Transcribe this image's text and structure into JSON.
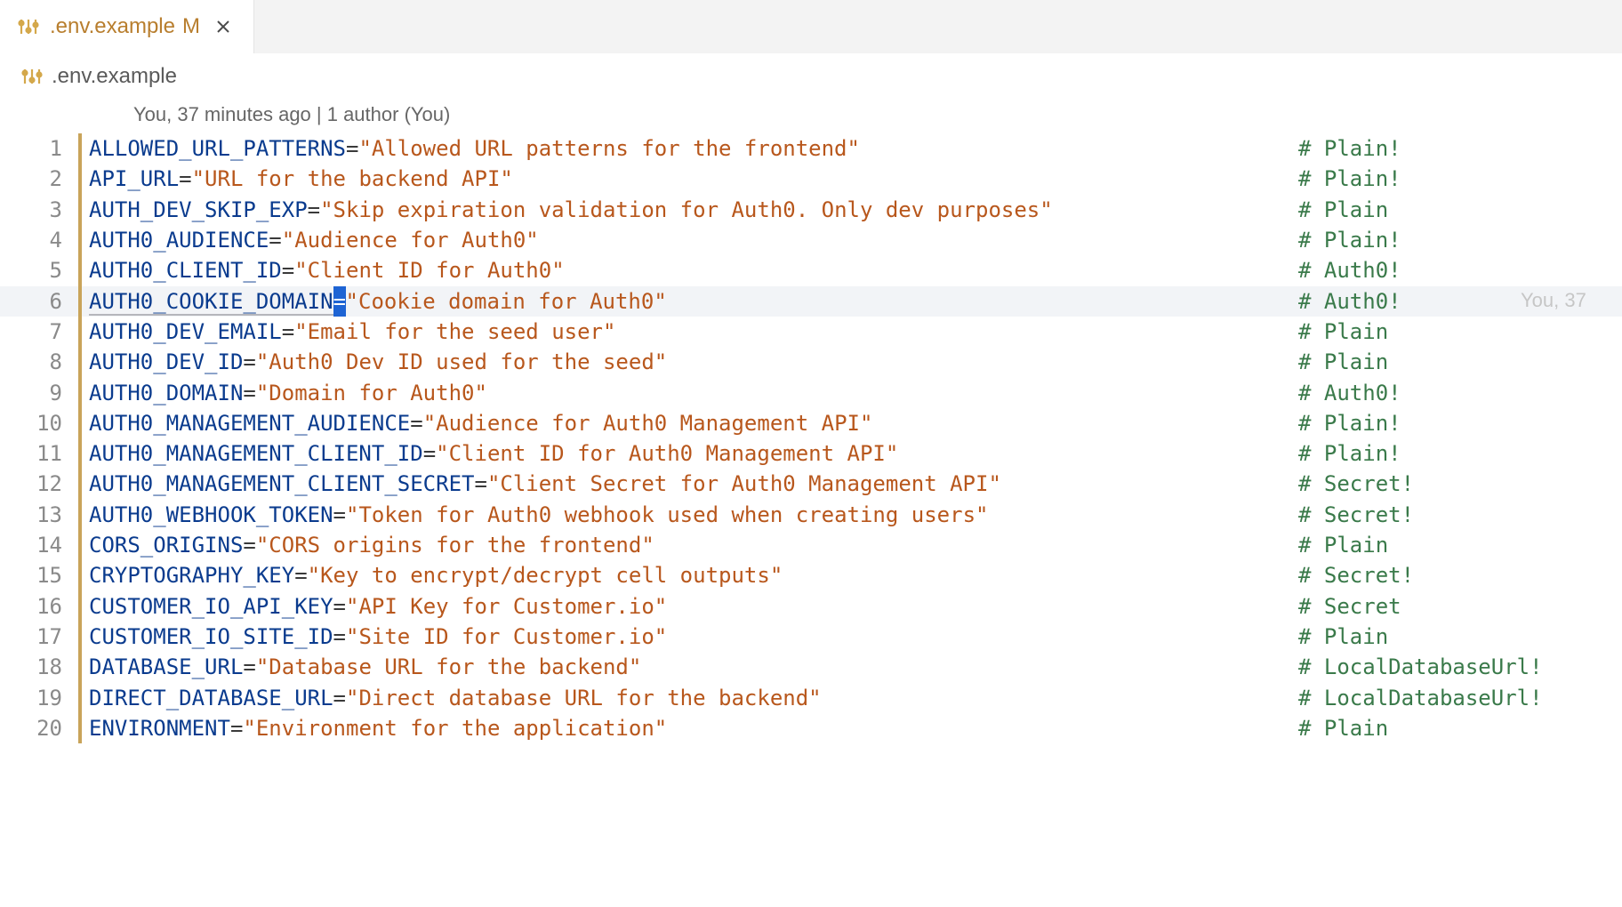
{
  "tab": {
    "filename": ".env.example",
    "modified_indicator": "M"
  },
  "breadcrumb": {
    "filename": ".env.example"
  },
  "blame": {
    "header": "You, 37 minutes ago | 1 author (You)",
    "inline": "You, 37"
  },
  "active_line": 6,
  "lines": [
    {
      "num": "1",
      "key": "ALLOWED_URL_PATTERNS",
      "value": "\"Allowed URL patterns for the frontend\"",
      "comment": "# Plain!"
    },
    {
      "num": "2",
      "key": "API_URL",
      "value": "\"URL for the backend API\"",
      "comment": "# Plain!"
    },
    {
      "num": "3",
      "key": "AUTH_DEV_SKIP_EXP",
      "value": "\"Skip expiration validation for Auth0. Only dev purposes\"",
      "comment": "# Plain"
    },
    {
      "num": "4",
      "key": "AUTH0_AUDIENCE",
      "value": "\"Audience for Auth0\"",
      "comment": "# Plain!"
    },
    {
      "num": "5",
      "key": "AUTH0_CLIENT_ID",
      "value": "\"Client ID for Auth0\"",
      "comment": "# Auth0!"
    },
    {
      "num": "6",
      "key": "AUTH0_COOKIE_DOMAIN",
      "value": "\"Cookie domain for Auth0\"",
      "comment": "# Auth0!"
    },
    {
      "num": "7",
      "key": "AUTH0_DEV_EMAIL",
      "value": "\"Email for the seed user\"",
      "comment": "# Plain"
    },
    {
      "num": "8",
      "key": "AUTH0_DEV_ID",
      "value": "\"Auth0 Dev ID used for the seed\"",
      "comment": "# Plain"
    },
    {
      "num": "9",
      "key": "AUTH0_DOMAIN",
      "value": "\"Domain for Auth0\"",
      "comment": "# Auth0!"
    },
    {
      "num": "10",
      "key": "AUTH0_MANAGEMENT_AUDIENCE",
      "value": "\"Audience for Auth0 Management API\"",
      "comment": "# Plain!"
    },
    {
      "num": "11",
      "key": "AUTH0_MANAGEMENT_CLIENT_ID",
      "value": "\"Client ID for Auth0 Management API\"",
      "comment": "# Plain!"
    },
    {
      "num": "12",
      "key": "AUTH0_MANAGEMENT_CLIENT_SECRET",
      "value": "\"Client Secret for Auth0 Management API\"",
      "comment": "# Secret!"
    },
    {
      "num": "13",
      "key": "AUTH0_WEBHOOK_TOKEN",
      "value": "\"Token for Auth0 webhook used when creating users\"",
      "comment": "# Secret!"
    },
    {
      "num": "14",
      "key": "CORS_ORIGINS",
      "value": "\"CORS origins for the frontend\"",
      "comment": "# Plain"
    },
    {
      "num": "15",
      "key": "CRYPTOGRAPHY_KEY",
      "value": "\"Key to encrypt/decrypt cell outputs\"",
      "comment": "# Secret!"
    },
    {
      "num": "16",
      "key": "CUSTOMER_IO_API_KEY",
      "value": "\"API Key for Customer.io\"",
      "comment": "# Secret"
    },
    {
      "num": "17",
      "key": "CUSTOMER_IO_SITE_ID",
      "value": "\"Site ID for Customer.io\"",
      "comment": "# Plain"
    },
    {
      "num": "18",
      "key": "DATABASE_URL",
      "value": "\"Database URL for the backend\"",
      "comment": "# LocalDatabaseUrl!"
    },
    {
      "num": "19",
      "key": "DIRECT_DATABASE_URL",
      "value": "\"Direct database URL for the backend\"",
      "comment": "# LocalDatabaseUrl!"
    },
    {
      "num": "20",
      "key": "ENVIRONMENT",
      "value": "\"Environment for the application\"",
      "comment": "# Plain"
    }
  ]
}
